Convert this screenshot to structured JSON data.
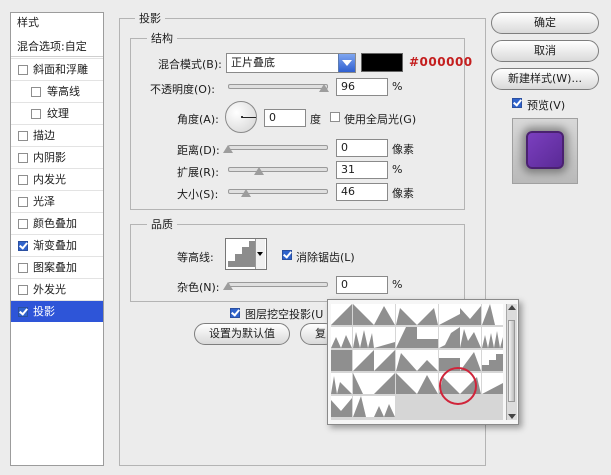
{
  "left_panel": {
    "header": "样式",
    "blend_options": "混合选项:自定",
    "items": [
      {
        "label": "斜面和浮雕",
        "checked": false,
        "indent": false,
        "selected": false
      },
      {
        "label": "等高线",
        "checked": false,
        "indent": true,
        "selected": false
      },
      {
        "label": "纹理",
        "checked": false,
        "indent": true,
        "selected": false
      },
      {
        "label": "描边",
        "checked": false,
        "indent": false,
        "selected": false
      },
      {
        "label": "内阴影",
        "checked": false,
        "indent": false,
        "selected": false
      },
      {
        "label": "内发光",
        "checked": false,
        "indent": false,
        "selected": false
      },
      {
        "label": "光泽",
        "checked": false,
        "indent": false,
        "selected": false
      },
      {
        "label": "颜色叠加",
        "checked": false,
        "indent": false,
        "selected": false
      },
      {
        "label": "渐变叠加",
        "checked": true,
        "indent": false,
        "selected": false
      },
      {
        "label": "图案叠加",
        "checked": false,
        "indent": false,
        "selected": false
      },
      {
        "label": "外发光",
        "checked": false,
        "indent": false,
        "selected": false
      },
      {
        "label": "投影",
        "checked": true,
        "indent": false,
        "selected": true
      }
    ]
  },
  "main": {
    "section_title": "投影",
    "structure": {
      "title": "结构",
      "blend_mode_label": "混合模式(B):",
      "blend_mode_value": "正片叠底",
      "color_hex_annotation": "#000000",
      "color_swatch": "#000000",
      "opacity_label": "不透明度(O):",
      "opacity_value": "96",
      "opacity_fraction": 0.96,
      "percent": "%",
      "angle_label": "角度(A):",
      "angle_value": "0",
      "angle_unit": "度",
      "global_light_label": "使用全局光(G)",
      "global_light_checked": false,
      "distance_label": "距离(D):",
      "distance_value": "0",
      "distance_fraction": 0,
      "spread_label": "扩展(R):",
      "spread_value": "31",
      "spread_fraction": 0.31,
      "size_label": "大小(S):",
      "size_value": "46",
      "size_fraction": 0.18,
      "pixel_unit": "像素"
    },
    "quality": {
      "title": "品质",
      "contour_label": "等高线:",
      "antialias_label": "消除锯齿(L)",
      "antialias_checked": true,
      "noise_label": "杂色(N):",
      "noise_value": "0",
      "noise_fraction": 0
    },
    "knockout_label": "图层挖空投影(U",
    "knockout_checked": true,
    "set_default_label": "设置为默认值",
    "reset_default_label": "复"
  },
  "right_panel": {
    "ok_label": "确定",
    "cancel_label": "取消",
    "new_style_label": "新建样式(W)...",
    "preview_label": "预览(V)",
    "preview_checked": true,
    "preview_color": "#7b3fbf"
  },
  "colors": {
    "selection": "#2e55d8",
    "annotation_red": "#c41e1e",
    "highlight_circle": "#d0243a"
  }
}
